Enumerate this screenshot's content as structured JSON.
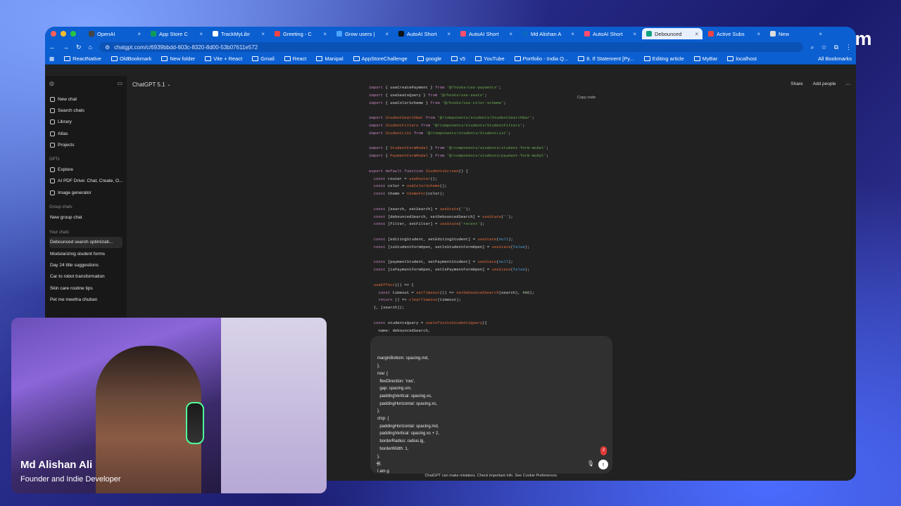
{
  "restream_logo": "Restream",
  "browser": {
    "tabs": [
      {
        "label": "OpenAI",
        "color": "#444"
      },
      {
        "label": "App Store C",
        "color": "#0f9d58"
      },
      {
        "label": "TrackMyLibr",
        "color": "#ffffff"
      },
      {
        "label": "Greeting - C",
        "color": "#e44"
      },
      {
        "label": "Grow users |",
        "color": "#4aa3ff"
      },
      {
        "label": "AutoAI Short",
        "color": "#111"
      },
      {
        "label": "AutoAI Short",
        "color": "#ff4d6d"
      },
      {
        "label": "Md Alishan A",
        "color": "#0a66c2"
      },
      {
        "label": "AutoAI Short",
        "color": "#ff4d6d"
      },
      {
        "label": "Debounced",
        "color": "#10a37f"
      },
      {
        "label": "Active Subs",
        "color": "#e44"
      },
      {
        "label": "New",
        "color": "#ddd"
      }
    ],
    "url": "chatgpt.com/c/6939bbdd-603c-8320-8d00-53b07611e572",
    "bookmarks": [
      "ReactNative",
      "OldBookmark",
      "New folder",
      "Vite + React",
      "Gmail",
      "React",
      "Manipal",
      "AppStoreChallenge",
      "google",
      "v5",
      "YouTube",
      "Portfolio - India Q...",
      "8. If Statement [Py...",
      "Editing article",
      "MyBar",
      "localhost"
    ],
    "all_bookmarks": "All Bookmarks"
  },
  "sidebar": {
    "top_items": [
      "New chat",
      "Search chats",
      "Library",
      "Atlas",
      "Projects"
    ],
    "gpts_head": "GPTs",
    "gpts": [
      "Explore",
      "AI PDF Drive: Chat, Create, O...",
      "Image generator"
    ],
    "group_head": "Group chats",
    "group": [
      "New group chat"
    ],
    "chats_head": "Your chats",
    "chats": [
      "Debounced search optimizati...",
      "Modularizing student forms",
      "Day 24 title suggestions",
      "Car to robot transformation",
      "Skin care routine tips",
      "Pet me meetha chuban"
    ]
  },
  "topbar": {
    "model": "ChatGPT 5.1",
    "share": "Share",
    "add_people": "Add people"
  },
  "copy_code": "Copy code",
  "composer_text": "marginBottom: spacing.md,\n},\nrow: {\n  flexDirection: 'row',\n  gap: spacing.sm,\n  paddingVertical: spacing.xs,\n  paddingHorizontal: spacing.xs,\n},\nchip: {\n  paddingHorizontal: spacing.md,\n  paddingVertical: spacing.xs + 2,\n  borderRadius: radius.lg,\n  borderWidth: 1,\n},\n});\nI am g",
  "badge": "2",
  "footer": "ChatGPT can make mistakes. Check important info. See Cookie Preferences.",
  "presenter": {
    "name": "Md Alishan Ali",
    "role": "Founder and Indie Developer"
  }
}
